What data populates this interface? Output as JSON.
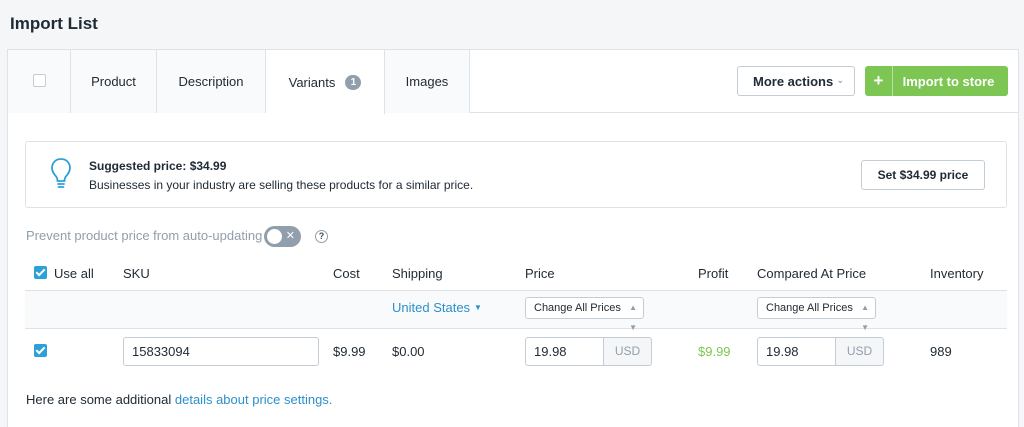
{
  "page": {
    "title": "Import List"
  },
  "tabs": [
    {
      "label": "Product"
    },
    {
      "label": "Description"
    },
    {
      "label": "Variants",
      "badge": "1"
    },
    {
      "label": "Images"
    }
  ],
  "actions": {
    "more_label": "More actions",
    "import_plus": "+",
    "import_label": "Import to store"
  },
  "suggestion": {
    "title": "Suggested price: $34.99",
    "description": "Businesses in your industry are selling these products for a similar price.",
    "button_label": "Set $34.99 price"
  },
  "prevent": {
    "label": "Prevent product price from auto-updating",
    "toggle_on": false,
    "help": "?"
  },
  "table": {
    "headers": {
      "use_all": "Use all",
      "sku": "SKU",
      "cost": "Cost",
      "shipping": "Shipping",
      "price": "Price",
      "profit": "Profit",
      "compared": "Compared At Price",
      "inventory": "Inventory"
    },
    "shipping_country": "United States",
    "change_all_price": "Change All Prices",
    "change_all_compared": "Change All Prices",
    "row": {
      "sku": "15833094",
      "cost": "$9.99",
      "shipping": "$0.00",
      "price": "19.98",
      "price_currency": "USD",
      "profit": "$9.99",
      "compared": "19.98",
      "compared_currency": "USD",
      "inventory": "989"
    }
  },
  "footer": {
    "text": "Here are some additional",
    "link": "details about price settings."
  },
  "colors": {
    "accent_green": "#7dc653",
    "link_blue": "#2c90cb",
    "checkbox_blue": "#2ea0d8"
  }
}
